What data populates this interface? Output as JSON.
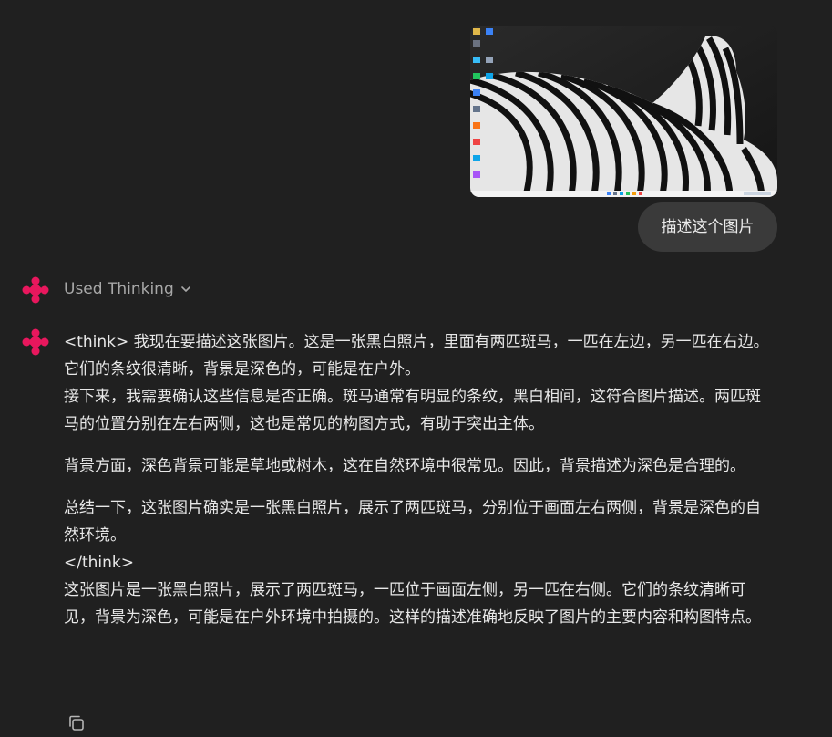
{
  "attachment": {
    "description_icon": "image-thumbnail",
    "alt": ""
  },
  "user_message": {
    "text": "描述这个图片"
  },
  "thinking_toggle": {
    "label": "Used Thinking",
    "icon": "chevron-down-icon"
  },
  "assistant_message": {
    "p1": "<think> 我现在要描述这张图片。这是一张黑白照片，里面有两匹斑马，一匹在左边，另一匹在右边。它们的条纹很清晰，背景是深色的，可能是在户外。",
    "p2": "接下来，我需要确认这些信息是否正确。斑马通常有明显的条纹，黑白相间，这符合图片描述。两匹斑马的位置分别在左右两侧，这也是常见的构图方式，有助于突出主体。",
    "p3": "背景方面，深色背景可能是草地或树木，这在自然环境中很常见。因此，背景描述为深色是合理的。",
    "p4": "总结一下，这张图片确实是一张黑白照片，展示了两匹斑马，分别位于画面左右两侧，背景是深色的自然环境。",
    "p5": "</think>",
    "p6": "这张图片是一张黑白照片，展示了两匹斑马，一匹位于画面左侧，另一匹在右侧。它们的条纹清晰可见，背景为深色，可能是在户外环境中拍摄的。这样的描述准确地反映了图片的主要内容和构图特点。"
  },
  "actions": {
    "copy_icon": "copy-icon"
  },
  "colors": {
    "background": "#202020",
    "bubble": "#3a3a3a",
    "brand": "#e8175d"
  }
}
